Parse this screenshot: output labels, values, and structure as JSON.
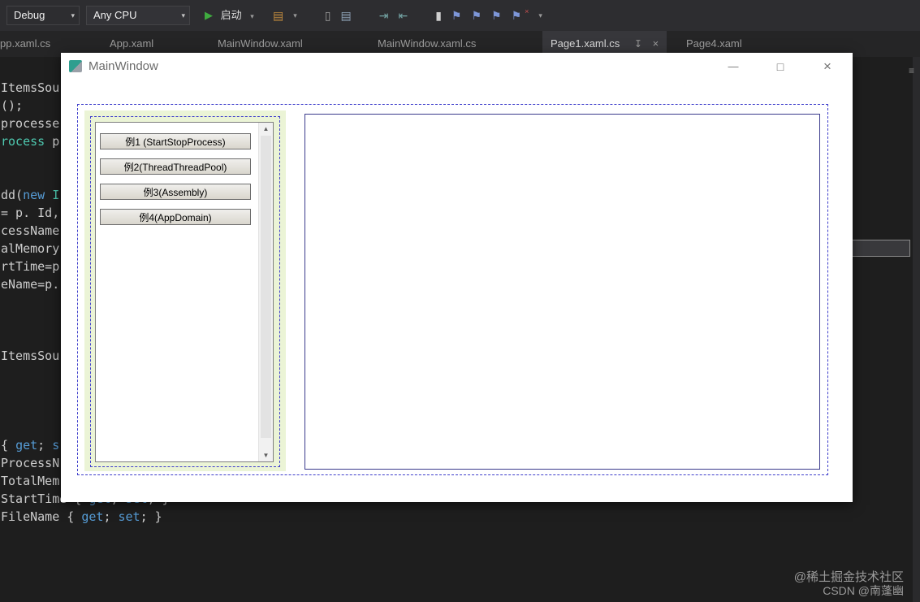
{
  "toolbar": {
    "debug_label": "Debug",
    "cpu_label": "Any CPU",
    "start_label": "启动"
  },
  "icons": {
    "caret": "▾",
    "play": "▶",
    "minimize": "—",
    "maximize": "□",
    "close": "×",
    "pin": "↧",
    "tab_close": "×",
    "scroll_up": "▲",
    "scroll_down": "▼",
    "doc_outline": "≡",
    "tb1": "▤",
    "tb2": "▯",
    "tb3": "▤",
    "tb4": "⇥",
    "tb5": "⇤",
    "tb6": "▮",
    "tb7": "⚑",
    "tb8": "⚑",
    "tb9": "⚑",
    "tb10": "⚑",
    "redx": "×"
  },
  "tabs": [
    {
      "label": "pp.xaml.cs"
    },
    {
      "label": "App.xaml"
    },
    {
      "label": "MainWindow.xaml"
    },
    {
      "label": "MainWindow.xaml.cs"
    },
    {
      "label": "Page1.xaml.cs"
    },
    {
      "label": "Page4.xaml"
    }
  ],
  "code": [
    [
      {
        "t": "ItemsSou"
      }
    ],
    [
      {
        "t": "();"
      }
    ],
    [
      {
        "t": "processe"
      }
    ],
    [
      {
        "t": "rocess"
      },
      {
        "t": " p"
      }
    ],
    [
      {
        "t": "dd("
      },
      {
        "t": "new"
      },
      {
        "t": " I"
      }
    ],
    [
      {
        "t": "= p. Id,"
      }
    ],
    [
      {
        "t": "cessName"
      }
    ],
    [
      {
        "t": "alMemory"
      }
    ],
    [
      {
        "t": "rtTime=p"
      }
    ],
    [
      {
        "t": "eName=p."
      }
    ],
    [
      {
        "t": "ItemsSou"
      }
    ],
    [
      {
        "t": "{ "
      },
      {
        "t": "get"
      },
      {
        "t": "; "
      },
      {
        "t": "s"
      }
    ],
    [
      {
        "t": "ProcessN"
      }
    ],
    [
      {
        "t": "TotalMem"
      }
    ],
    [
      {
        "t": "StartTime { "
      },
      {
        "t": "get"
      },
      {
        "t": "; "
      },
      {
        "t": "set"
      },
      {
        "t": "; }"
      }
    ],
    [
      {
        "t": "FileName { "
      },
      {
        "t": "get"
      },
      {
        "t": "; "
      },
      {
        "t": "set"
      },
      {
        "t": "; }"
      }
    ]
  ],
  "app": {
    "title": "MainWindow",
    "buttons": [
      "例1 (StartStopProcess)",
      "例2(ThreadThreadPool)",
      "例3(Assembly)",
      "例4(AppDomain)"
    ]
  },
  "watermark": {
    "line1": "@稀土掘金技术社区",
    "line2": "CSDN @南蓬幽"
  }
}
